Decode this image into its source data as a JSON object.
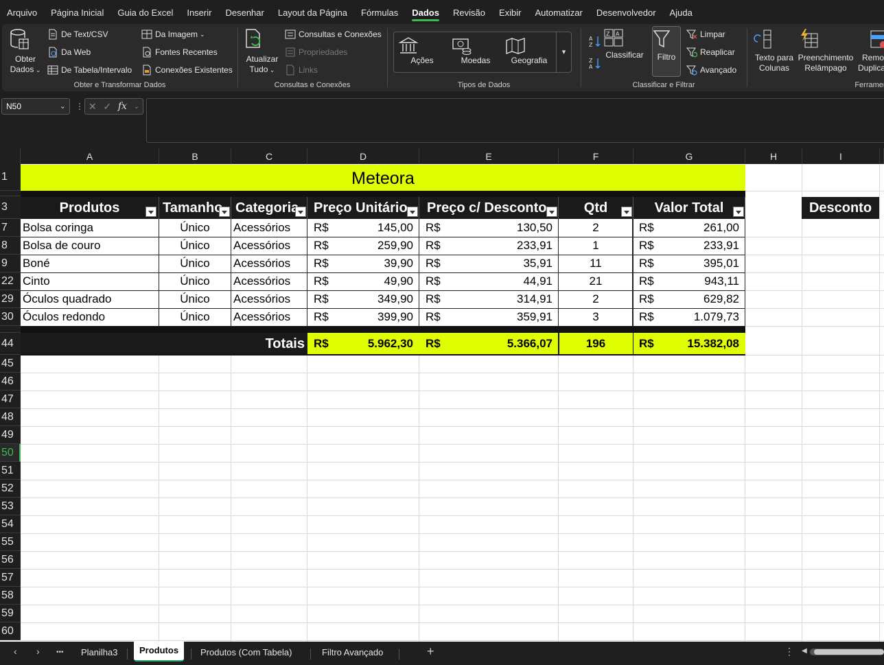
{
  "menu": {
    "tabs": [
      "Arquivo",
      "Página Inicial",
      "Guia do Excel",
      "Inserir",
      "Desenhar",
      "Layout da Página",
      "Fórmulas",
      "Dados",
      "Revisão",
      "Exibir",
      "Automatizar",
      "Desenvolvedor",
      "Ajuda"
    ],
    "active": "Dados"
  },
  "ribbon": {
    "obter": {
      "obter_dados": "Obter\nDados",
      "obter_dados_l1": "Obter",
      "obter_dados_l2": "Dados",
      "de_text_csv": "De Text/CSV",
      "da_web": "Da Web",
      "de_tabela": "De Tabela/Intervalo",
      "da_imagem": "Da Imagem",
      "fontes_recentes": "Fontes Recentes",
      "conexoes_existentes": "Conexões Existentes",
      "label": "Obter e Transformar Dados"
    },
    "consultas": {
      "atualizar_l1": "Atualizar",
      "atualizar_l2": "Tudo",
      "consultas_conexoes": "Consultas e Conexões",
      "propriedades": "Propriedades",
      "links": "Links",
      "label": "Consultas e Conexões"
    },
    "tipos": {
      "acoes": "Ações",
      "moedas": "Moedas",
      "geografia": "Geografia",
      "label": "Tipos de Dados"
    },
    "classificar": {
      "classificar": "Classificar",
      "filtro": "Filtro",
      "limpar": "Limpar",
      "reaplicar": "Reaplicar",
      "avancado": "Avançado",
      "label": "Classificar e Filtrar"
    },
    "ferramentas": {
      "texto_l1": "Texto para",
      "texto_l2": "Colunas",
      "preench_l1": "Preenchimento",
      "preench_l2": "Relâmpago",
      "remover_l1": "Remov",
      "remover_l2": "Duplica",
      "label": "Ferramen"
    }
  },
  "formula_bar": {
    "name_box": "N50",
    "fx": "fx",
    "content": ""
  },
  "columns": [
    "A",
    "B",
    "C",
    "D",
    "E",
    "F",
    "G",
    "H",
    "I"
  ],
  "row_numbers": [
    "1",
    "3",
    "7",
    "8",
    "9",
    "22",
    "29",
    "30",
    "44",
    "45",
    "46",
    "47",
    "48",
    "49",
    "50",
    "51",
    "52",
    "53",
    "54",
    "55",
    "56",
    "57",
    "58",
    "59",
    "60"
  ],
  "sheet": {
    "title": "Meteora",
    "headers": [
      "Produtos",
      "Tamanho",
      "Categoria",
      "Preço Unitário",
      "Preço c/ Desconto",
      "Qtd",
      "Valor Total"
    ],
    "extra_header": "Desconto",
    "currency": "R$",
    "rows": [
      {
        "produto": "Bolsa coringa",
        "tamanho": "Único",
        "categoria": "Acessórios",
        "preco": "145,00",
        "desconto": "130,50",
        "qtd": "2",
        "total": "261,00"
      },
      {
        "produto": "Bolsa de couro",
        "tamanho": "Único",
        "categoria": "Acessórios",
        "preco": "259,90",
        "desconto": "233,91",
        "qtd": "1",
        "total": "233,91"
      },
      {
        "produto": "Boné",
        "tamanho": "Único",
        "categoria": "Acessórios",
        "preco": "39,90",
        "desconto": "35,91",
        "qtd": "11",
        "total": "395,01"
      },
      {
        "produto": "Cinto",
        "tamanho": "Único",
        "categoria": "Acessórios",
        "preco": "49,90",
        "desconto": "44,91",
        "qtd": "21",
        "total": "943,11"
      },
      {
        "produto": "Óculos quadrado",
        "tamanho": "Único",
        "categoria": "Acessórios",
        "preco": "349,90",
        "desconto": "314,91",
        "qtd": "2",
        "total": "629,82"
      },
      {
        "produto": "Óculos redondo",
        "tamanho": "Único",
        "categoria": "Acessórios",
        "preco": "399,90",
        "desconto": "359,91",
        "qtd": "3",
        "total": "1.079,73"
      }
    ],
    "totals": {
      "label": "Totais",
      "preco": "5.962,30",
      "desconto": "5.366,07",
      "qtd": "196",
      "total": "15.382,08"
    }
  },
  "tabs": {
    "sheets": [
      "Planilha3",
      "Produtos",
      "Produtos (Com Tabela)",
      "Filtro Avançado"
    ],
    "active": "Produtos",
    "more": "•••",
    "add": "+"
  },
  "colors": {
    "accent_yellow": "#dfff00",
    "header_dark": "#1a1a1a",
    "selection_green": "#3fb950"
  }
}
